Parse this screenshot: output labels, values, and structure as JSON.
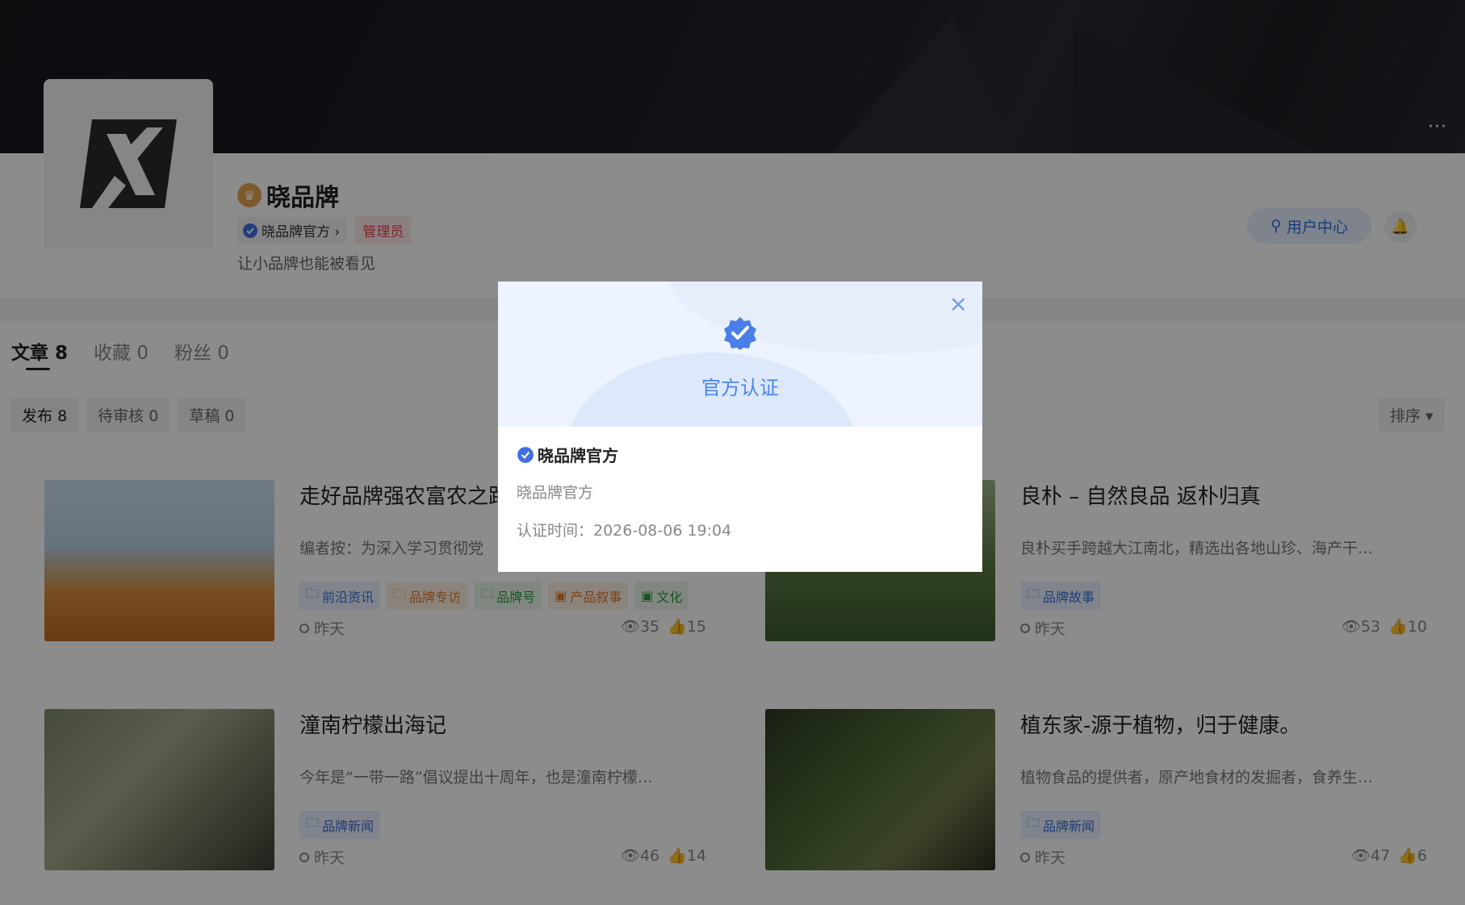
{
  "profile": {
    "name": "晓品牌",
    "verify_label": "晓品牌官方 ›",
    "role": "管理员",
    "bio": "让小品牌也能被看见",
    "user_center": "用户中心",
    "more": "···"
  },
  "tabs": [
    {
      "label": "文章",
      "count": "8"
    },
    {
      "label": "收藏",
      "count": "0"
    },
    {
      "label": "粉丝",
      "count": "0"
    }
  ],
  "subtabs": [
    {
      "label": "发布",
      "count": "8"
    },
    {
      "label": "待审核",
      "count": "0"
    },
    {
      "label": "草稿",
      "count": "0"
    }
  ],
  "sort_label": "排序 ▾",
  "articles": [
    {
      "title": "走好品牌强农富农之路",
      "desc": "编者按：为深入学习贯彻党",
      "tags": [
        "前沿资讯",
        "品牌专访",
        "品牌号",
        "产品叙事",
        "文化"
      ],
      "time": "昨天",
      "views": "35",
      "likes": "15"
    },
    {
      "title": "良朴 – 自然良品 返朴归真",
      "desc": "良朴买手跨越大江南北，精选出各地山珍、海产干…",
      "tags": [
        "品牌故事"
      ],
      "time": "昨天",
      "views": "53",
      "likes": "10"
    },
    {
      "title": "潼南柠檬出海记",
      "desc": "今年是“一带一路”倡议提出十周年，也是潼南柠檬…",
      "tags": [
        "品牌新闻"
      ],
      "time": "昨天",
      "views": "46",
      "likes": "14"
    },
    {
      "title": "植东家-源于植物，归于健康。",
      "desc": "植物食品的提供者，原产地食材的发掘者，食养生…",
      "tags": [
        "品牌新闻"
      ],
      "time": "昨天",
      "views": "47",
      "likes": "6"
    }
  ],
  "modal": {
    "heading": "官方认证",
    "name": "晓品牌官方",
    "subtitle": "晓品牌官方",
    "time": "认证时间：2026-08-06 19:04",
    "close": "×"
  },
  "colors": {
    "accent": "#4a86e8",
    "admin": "#e0464f",
    "banner": "#1e2026"
  }
}
